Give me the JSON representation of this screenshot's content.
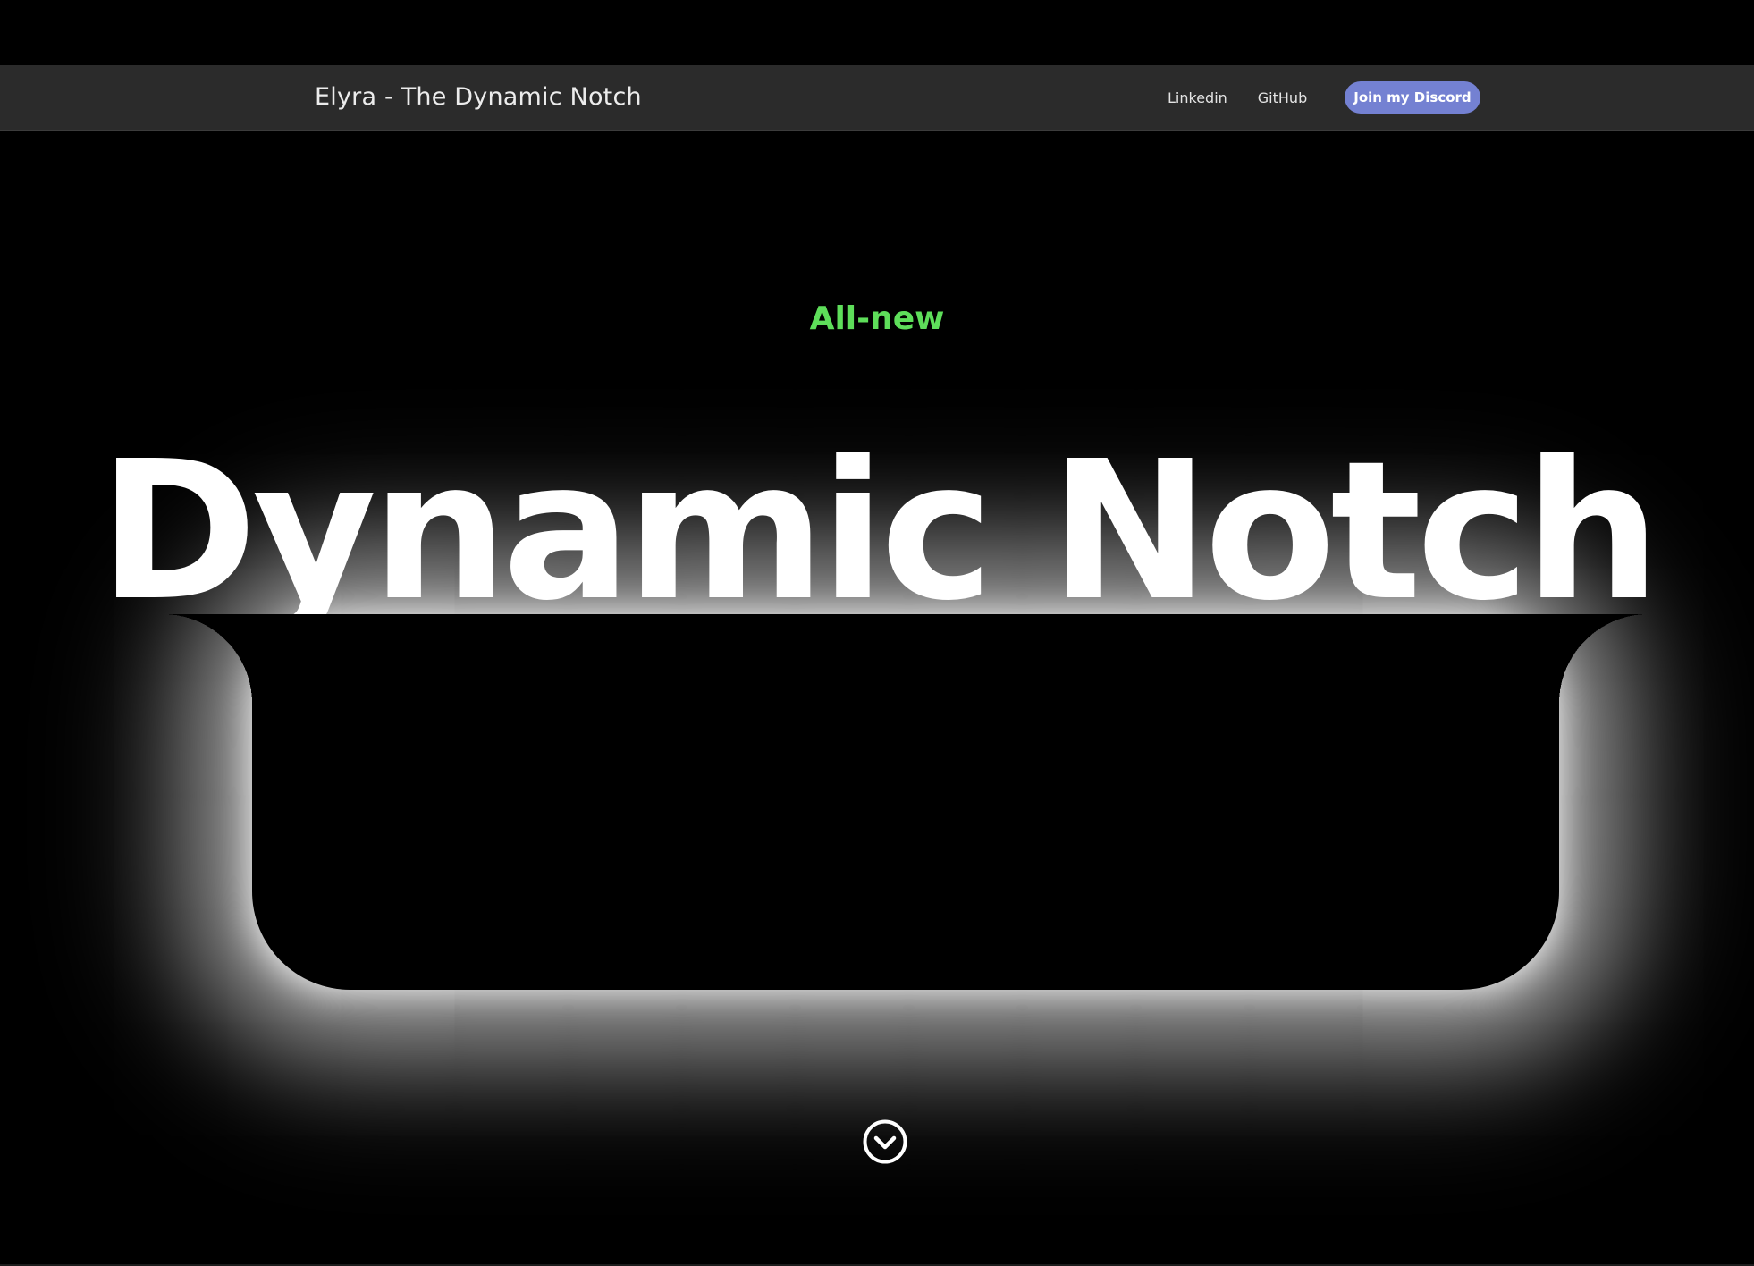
{
  "navbar": {
    "brand": "Elyra - The Dynamic Notch",
    "links": [
      {
        "label": "Linkedin"
      },
      {
        "label": "GitHub"
      }
    ],
    "cta_label": "Join my Discord"
  },
  "hero": {
    "eyebrow": "All-new",
    "headline": "Dynamic Notch",
    "scroll_icon": "chevron-down-circle-icon"
  },
  "colors": {
    "background": "#000000",
    "navbar": "#2b2b2b",
    "accent_green": "#5ede5a",
    "discord_button": "#7481d2",
    "text": "#ffffff"
  }
}
